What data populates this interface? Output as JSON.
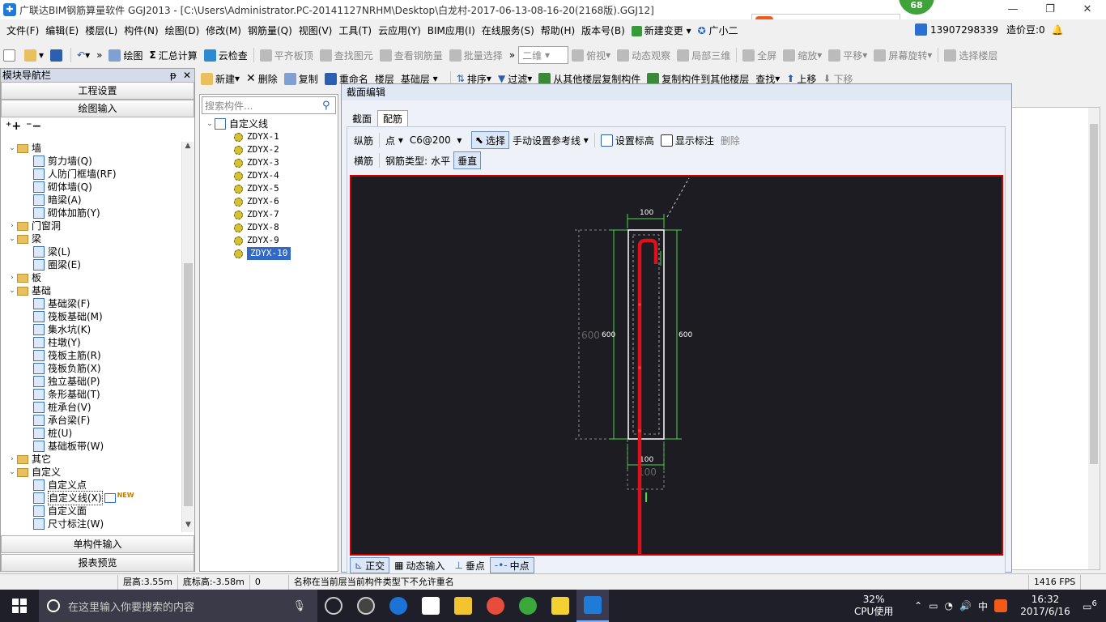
{
  "window": {
    "title": "广联达BIM钢筋算量软件 GGJ2013 - [C:\\Users\\Administrator.PC-20141127NRHM\\Desktop\\白龙村-2017-06-13-08-16-20(2168版).GGJ12]",
    "badge": "68",
    "minimize": "—",
    "restore": "❐",
    "close": "✕"
  },
  "menu": [
    "文件(F)",
    "编辑(E)",
    "楼层(L)",
    "构件(N)",
    "绘图(D)",
    "修改(M)",
    "钢筋量(Q)",
    "视图(V)",
    "工具(T)",
    "云应用(Y)",
    "BIM应用(I)",
    "在线服务(S)",
    "帮助(H)",
    "版本号(B)",
    "新建变更",
    "广小二"
  ],
  "menu_right": {
    "phone": "13907298339",
    "price": "造价豆:0"
  },
  "toolbar1": {
    "draw": "绘图",
    "sum": "汇总计算",
    "cloud_check": "云检查",
    "align_top": "平齐板顶",
    "find_element": "查找图元",
    "view_rebar": "查看钢筋量",
    "batch_select": "批量选择",
    "view_mode": "二维",
    "top_view": "俯视",
    "dynamic": "动态观察",
    "local3d": "局部三维",
    "fullscreen": "全屏",
    "zoom": "缩放",
    "pan": "平移",
    "rotate": "屏幕旋转",
    "select_floor": "选择楼层"
  },
  "toolbar2": {
    "new": "新建",
    "delete": "删除",
    "copy": "复制",
    "rename": "重命名",
    "floor_label": "楼层",
    "floor_value": "基础层",
    "sort": "排序",
    "filter": "过滤",
    "copy_from": "从其他楼层复制构件",
    "copy_to": "复制构件到其他楼层",
    "find": "查找",
    "up": "上移",
    "down": "下移"
  },
  "leftpanel": {
    "title": "模块导航栏",
    "pin": "ᵽ",
    "close": "✕",
    "btn_settings": "工程设置",
    "btn_draw": "绘图输入",
    "btn_single": "单构件输入",
    "btn_report": "报表预览",
    "new_badge": "NEW",
    "tree": [
      {
        "label": "墙",
        "level": 0,
        "caret": "⌄",
        "folder": true
      },
      {
        "label": "剪力墙(Q)",
        "level": 1
      },
      {
        "label": "人防门框墙(RF)",
        "level": 1
      },
      {
        "label": "砌体墙(Q)",
        "level": 1
      },
      {
        "label": "暗梁(A)",
        "level": 1
      },
      {
        "label": "砌体加筋(Y)",
        "level": 1
      },
      {
        "label": "门窗洞",
        "level": 0,
        "caret": "›",
        "folder": true
      },
      {
        "label": "梁",
        "level": 0,
        "caret": "⌄",
        "folder": true
      },
      {
        "label": "梁(L)",
        "level": 1
      },
      {
        "label": "圈梁(E)",
        "level": 1
      },
      {
        "label": "板",
        "level": 0,
        "caret": "›",
        "folder": true
      },
      {
        "label": "基础",
        "level": 0,
        "caret": "⌄",
        "folder": true
      },
      {
        "label": "基础梁(F)",
        "level": 1
      },
      {
        "label": "筏板基础(M)",
        "level": 1
      },
      {
        "label": "集水坑(K)",
        "level": 1
      },
      {
        "label": "柱墩(Y)",
        "level": 1
      },
      {
        "label": "筏板主筋(R)",
        "level": 1
      },
      {
        "label": "筏板负筋(X)",
        "level": 1
      },
      {
        "label": "独立基础(P)",
        "level": 1
      },
      {
        "label": "条形基础(T)",
        "level": 1
      },
      {
        "label": "桩承台(V)",
        "level": 1
      },
      {
        "label": "承台梁(F)",
        "level": 1
      },
      {
        "label": "桩(U)",
        "level": 1
      },
      {
        "label": "基础板带(W)",
        "level": 1
      },
      {
        "label": "其它",
        "level": 0,
        "caret": "›",
        "folder": true
      },
      {
        "label": "自定义",
        "level": 0,
        "caret": "⌄",
        "folder": true
      },
      {
        "label": "自定义点",
        "level": 1
      },
      {
        "label": "自定义线(X)",
        "level": 1,
        "selected": true
      },
      {
        "label": "自定义面",
        "level": 1
      },
      {
        "label": "尺寸标注(W)",
        "level": 1
      }
    ]
  },
  "midpanel": {
    "search_placeholder": "搜索构件...",
    "root": "自定义线",
    "items": [
      "ZDYX-1",
      "ZDYX-2",
      "ZDYX-3",
      "ZDYX-4",
      "ZDYX-5",
      "ZDYX-6",
      "ZDYX-7",
      "ZDYX-8",
      "ZDYX-9",
      "ZDYX-10"
    ],
    "selected": "ZDYX-10"
  },
  "dialog": {
    "title": "截面编辑",
    "tabs": [
      "截面",
      "配筋"
    ],
    "active_tab": "配筋",
    "row1": {
      "longitudinal": "纵筋",
      "point": "点",
      "spec": "C6@200",
      "select": "选择",
      "manual_ref": "手动设置参考线",
      "set_elev": "设置标高",
      "show_label": "显示标注",
      "delete": "删除"
    },
    "row2": {
      "transverse": "横筋",
      "type_label": "钢筋类型:",
      "horizontal": "水平",
      "vertical": "垂直"
    },
    "dims": {
      "top": "100",
      "left": "600",
      "left_far": "600",
      "right": "600",
      "bottom": "100",
      "bottom2": "100"
    },
    "bottom_buttons": [
      "正交",
      "动态输入",
      "垂点",
      "中点"
    ]
  },
  "status": {
    "floor_height": "层高:3.55m",
    "base_elev": "底标高:-3.58m",
    "zero": "0",
    "message": "名称在当前层当前构件类型下不允许重名",
    "fps": "1416 FPS"
  },
  "taskbar": {
    "search_placeholder": "在这里输入你要搜索的内容",
    "cpu_percent": "32%",
    "cpu_label": "CPU使用",
    "ime": "中",
    "time": "16:32",
    "date": "2017/6/16",
    "notify": "6"
  },
  "colors": {
    "canvas_bg": "#1c1c22",
    "rebar": "#e0101a",
    "dim": "#4cd94c",
    "outline": "#ffffff",
    "selection": "#3169c6"
  }
}
